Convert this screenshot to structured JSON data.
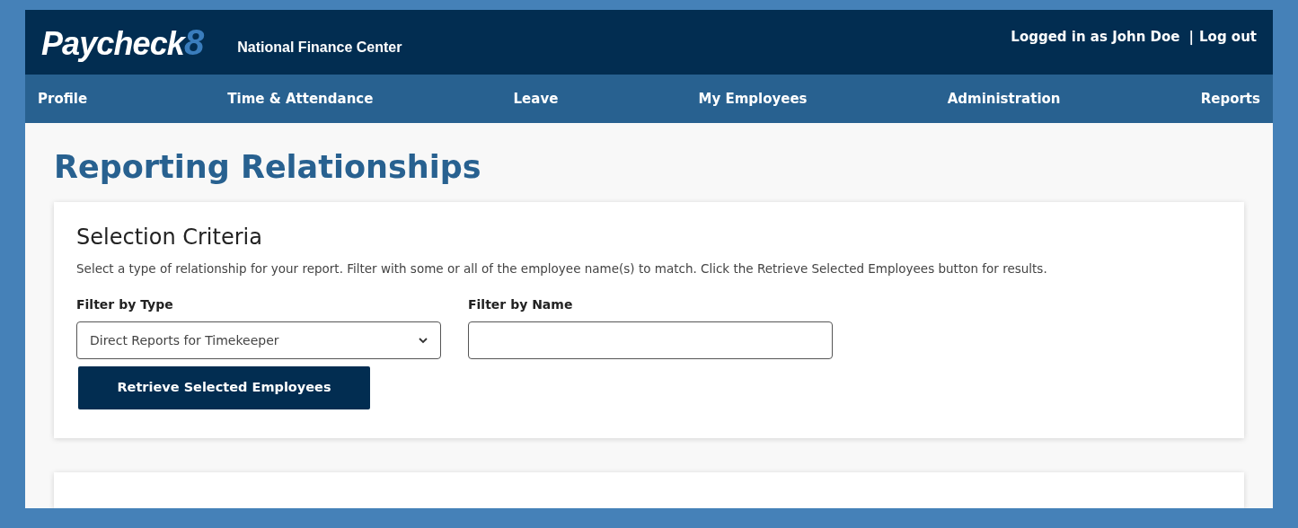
{
  "header": {
    "logo": {
      "text": "Paycheck",
      "accent": "8"
    },
    "subtitle": "National Finance Center",
    "user": "Logged in as John Doe",
    "separator": "|",
    "logout": "Log out"
  },
  "nav": [
    {
      "label": "Profile"
    },
    {
      "label": "Time & Attendance"
    },
    {
      "label": "Leave"
    },
    {
      "label": "My Employees"
    },
    {
      "label": "Administration"
    },
    {
      "label": "Reports"
    }
  ],
  "page_title": "Reporting Relationships",
  "selection_criteria": {
    "title": "Selection Criteria",
    "description": "Select a type of relationship for your report. Filter with some or all of the employee name(s) to match. Click the Retrieve Selected Employees button for results.",
    "filter_type": {
      "label": "Filter by Type",
      "value": "Direct Reports for Timekeeper"
    },
    "filter_name": {
      "label": "Filter by Name"
    },
    "button": "Retrieve Selected Employees"
  }
}
